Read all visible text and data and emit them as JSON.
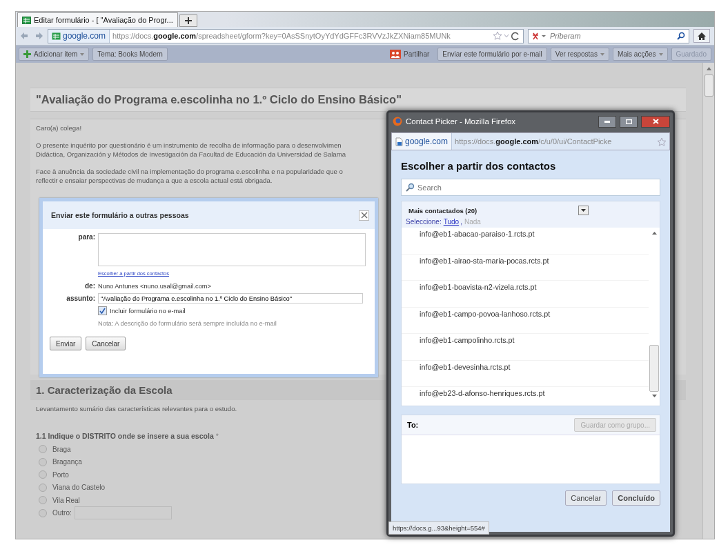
{
  "browser": {
    "tab": {
      "title": "Editar formulário - [ \"Avaliação do Progr..."
    },
    "identity": "google.com",
    "url": "https://docs.**google.com**/spreadsheet/gform?key=0AsSSnytOyYdYdGFFc3RVVzJkZXNiam85MUNk",
    "search": {
      "placeholder": "Priberam"
    }
  },
  "toolbar": {
    "left": [
      {
        "label": "Adicionar item",
        "kind": "add",
        "disabled": false
      },
      {
        "label": "Tema:  Books Modern",
        "kind": "plain",
        "disabled": false
      }
    ],
    "right": [
      {
        "label": "Partilhar",
        "kind": "share",
        "disabled": false
      },
      {
        "label": "Enviar este formulário por e-mail",
        "kind": "plain",
        "disabled": false
      },
      {
        "label": "Ver respostas",
        "kind": "menu",
        "disabled": false
      },
      {
        "label": "Mais acções",
        "kind": "menu",
        "disabled": false
      },
      {
        "label": "Guardado",
        "kind": "plain",
        "disabled": true
      }
    ]
  },
  "form": {
    "title": "\"Avaliação do Programa e.escolinha no 1.º Ciclo do Ensino Básico\"",
    "description": [
      "Caro(a) colega!",
      "O presente inquérito por  questionário é um instrumento de recolha de informação para o desenvolvimen",
      "Didáctica, Organización y Métodos de Investigación da Facultad de Educación da Universidad de Salama",
      "Face à anuência da sociedade civil na implementação do programa e.escolinha e na popularidade que o",
      "reflectir e ensaiar perspectivas de mudança a que a escola actual está obrigada."
    ],
    "section": {
      "title": "1. Caracterização da Escola",
      "description": "Levantamento sumário das características relevantes para o estudo."
    },
    "question": {
      "title": "1.1 Indique o DISTRITO onde se insere a sua escola",
      "required_mark": "*",
      "options": [
        {
          "label": "Braga",
          "selected": false,
          "kind": "radio"
        },
        {
          "label": "Bragança",
          "selected": false,
          "kind": "radio"
        },
        {
          "label": "Porto",
          "selected": false,
          "kind": "radio"
        },
        {
          "label": "Viana do Castelo",
          "selected": false,
          "kind": "radio"
        },
        {
          "label": "Vila Real",
          "selected": false,
          "kind": "radio"
        },
        {
          "label": "Outro:",
          "selected": false,
          "kind": "other"
        }
      ]
    }
  },
  "send_dialog": {
    "title": "Enviar este formulário a outras pessoas",
    "to_label": "para:",
    "pick_link": "Escolher a partir dos contactos",
    "from_label": "de:",
    "from_value": "Nuno Antunes <nuno.usal@gmail.com>",
    "subject_label": "assunto:",
    "subject_value": "\"Avaliação do Programa e.escolinha no 1.º Ciclo do Ensino Básico\"",
    "include": {
      "label": "Incluir formulário no e-mail",
      "checked": true
    },
    "note": "Nota: A descrição do formulário será sempre incluída no e-mail",
    "buttons": [
      "Enviar",
      "Cancelar"
    ]
  },
  "picker": {
    "window_title": "Contact Picker - Mozilla Firefox",
    "identity": "google.com",
    "url": "https://docs.**google.com**/c/u/0/ui/ContactPicke",
    "heading": "Escolher a partir dos contactos",
    "search": {
      "placeholder": "Search"
    },
    "group": "Mais contactados (20)",
    "select_label": "Seleccione:",
    "select_options": [
      {
        "label": "Tudo",
        "disabled": false
      },
      {
        "label": "Nada",
        "disabled": true
      }
    ],
    "separator": ",",
    "contacts": [
      "info@eb1-abacao-paraiso-1.rcts.pt",
      "info@eb1-airao-sta-maria-pocas.rcts.pt",
      "info@eb1-boavista-n2-vizela.rcts.pt",
      "info@eb1-campo-povoa-lanhoso.rcts.pt",
      "info@eb1-campolinho.rcts.pt",
      "info@eb1-devesinha.rcts.pt",
      "info@eb23-d-afonso-henriques.rcts.pt"
    ],
    "to_label": "To:",
    "save_group": {
      "label": "Guardar como grupo...",
      "disabled": true
    },
    "buttons": [
      "Cancelar",
      "Concluído"
    ],
    "status": "https://docs.g...93&height=554#"
  }
}
